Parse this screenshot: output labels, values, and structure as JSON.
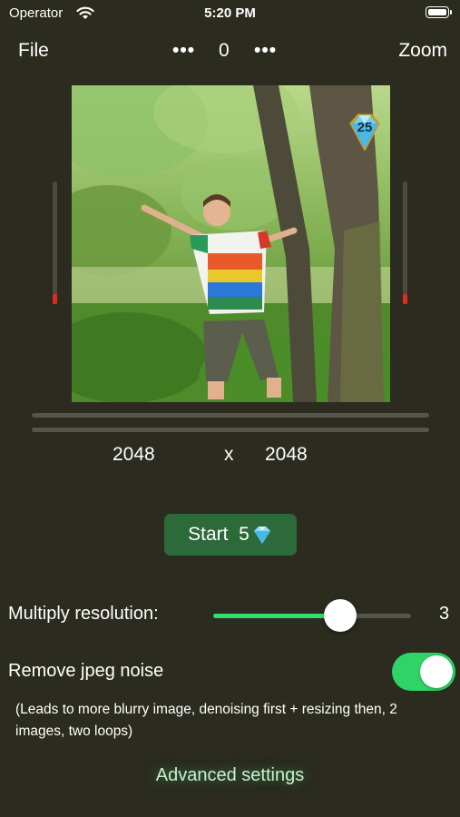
{
  "status": {
    "carrier": "Operator",
    "time": "5:20 PM"
  },
  "toolbar": {
    "file_label": "File",
    "dots_left": "•••",
    "counter": "0",
    "dots_right": "•••",
    "zoom_label": "Zoom"
  },
  "image": {
    "gem_count": "25",
    "left_meter_level": 0.08,
    "right_meter_level": 0.08
  },
  "dimensions": {
    "width": "2048",
    "separator": "x",
    "height": "2048"
  },
  "start": {
    "label": "Start  5",
    "icon": "gem-icon"
  },
  "multiply": {
    "label": "Multiply resolution:",
    "value": "3",
    "slider_fraction": 0.64
  },
  "jpeg_noise": {
    "label": "Remove jpeg noise",
    "enabled": true,
    "note": "(Leads to more blurry image, denoising first + resizing then, 2 images, two loops)"
  },
  "advanced_label": "Advanced settings",
  "colors": {
    "background": "#2b2b1f",
    "accent_green": "#2fe06a",
    "start_button": "#2d6a3a",
    "meter_red": "#e22b20"
  }
}
